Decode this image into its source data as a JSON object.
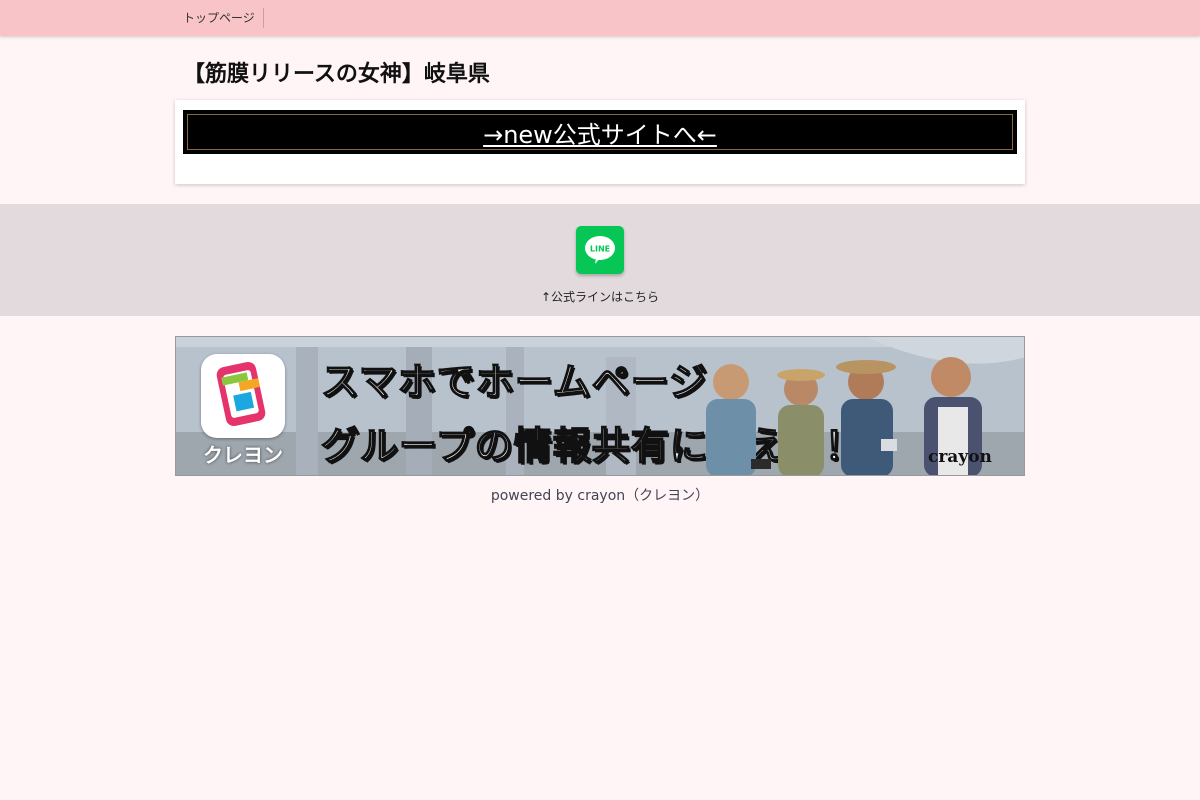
{
  "header": {
    "nav_items": [
      "トップページ"
    ]
  },
  "page": {
    "title": "【筋膜リリースの女神】岐阜県"
  },
  "content": {
    "banner_link_text": "→new公式サイトへ←"
  },
  "line_section": {
    "icon_text": "LINE",
    "caption": "↑公式ラインはこちら",
    "color": "#06c755"
  },
  "ad": {
    "app_name": "クレヨン",
    "line1": "スマホでホームページ",
    "line2": "グループの情報共有に使える！",
    "brand": "crayon"
  },
  "footer": {
    "powered_by": "powered by crayon（クレヨン）"
  }
}
